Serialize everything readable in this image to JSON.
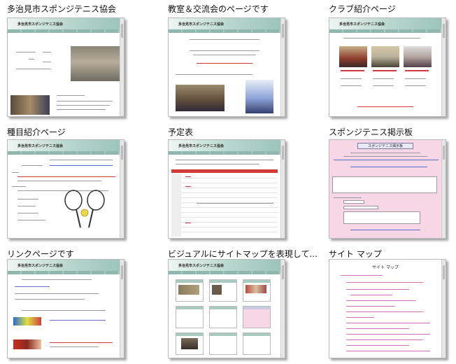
{
  "items": [
    {
      "title": "多治見市スポンジテニス協会",
      "site_title": "多治見市スポンジテニス協会"
    },
    {
      "title": "教室＆交流会のページです",
      "site_title": "多治見市スポンジテニス協会"
    },
    {
      "title": "クラブ紹介ページ",
      "site_title": "多治見市スポンジテニス協会"
    },
    {
      "title": "種目紹介ページ",
      "site_title": "多治見市スポンジテニス協会"
    },
    {
      "title": "予定表",
      "site_title": "多治見市スポンジテニス協会"
    },
    {
      "title": "スポンジテニス掲示板",
      "site_title": "スポンジテニス掲示板"
    },
    {
      "title": "リンクページです",
      "site_title": "多治見市スポンジテニス協会"
    },
    {
      "title": "ビジュアルにサイトマップを表現して...",
      "site_title": "多治見市スポンジテニス協会"
    },
    {
      "title": "サイト マップ",
      "site_title": "サイト マップ"
    }
  ],
  "colors": {
    "header_teal": "#9cc5ba",
    "board_pink": "#f7d6e6",
    "link_blue": "#2233bb",
    "accent_red": "#d23a3a"
  }
}
